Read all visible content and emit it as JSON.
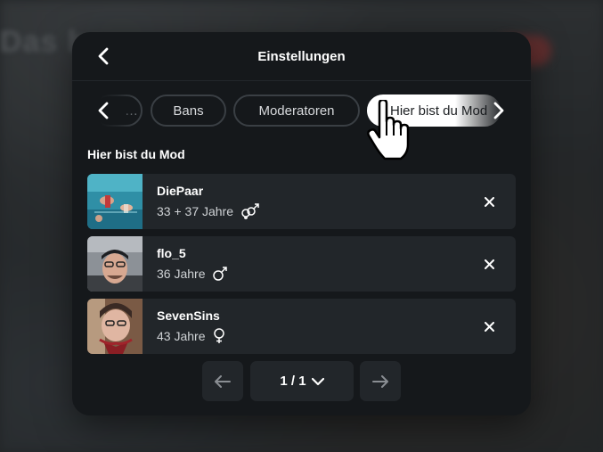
{
  "modal": {
    "title": "Einstellungen"
  },
  "tabs": {
    "partial_label": "…",
    "items": [
      {
        "label": "Bans"
      },
      {
        "label": "Moderatoren"
      },
      {
        "label": "Hier bist du Mod",
        "active": true
      }
    ]
  },
  "section": {
    "title": "Hier bist du Mod"
  },
  "users": [
    {
      "name": "DiePaar",
      "age": "33 + 37 Jahre",
      "gender": "couple-icon"
    },
    {
      "name": "flo_5",
      "age": "36 Jahre",
      "gender": "male-icon"
    },
    {
      "name": "SevenSins",
      "age": "43 Jahre",
      "gender": "female-icon"
    }
  ],
  "pagination": {
    "page_label": "1 / 1"
  },
  "colors": {
    "modal_bg": "#15181b",
    "row_bg": "#22262a",
    "active_tab_bg": "#ffffff",
    "tab_border": "#3a3f44"
  }
}
